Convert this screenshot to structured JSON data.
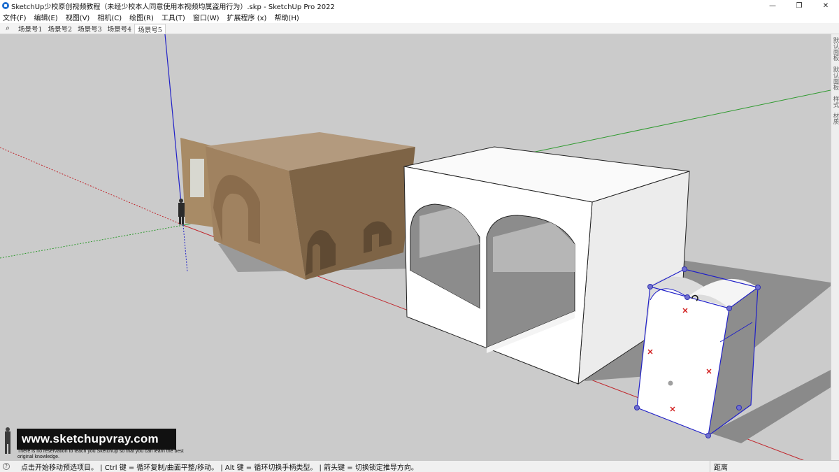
{
  "window": {
    "title": "SketchUp少校原创视频教程（未经少校本人同意使用本视频均属盗用行为）.skp - SketchUp Pro 2022",
    "controls": {
      "minimize": "—",
      "maximize": "❐",
      "close": "✕"
    }
  },
  "menu": [
    {
      "label": "文件(F)"
    },
    {
      "label": "编辑(E)"
    },
    {
      "label": "视图(V)"
    },
    {
      "label": "相机(C)"
    },
    {
      "label": "绘图(R)"
    },
    {
      "label": "工具(T)"
    },
    {
      "label": "窗口(W)"
    },
    {
      "label": "扩展程序 (x)"
    },
    {
      "label": "帮助(H)"
    }
  ],
  "scenes": {
    "search_icon": "⌕",
    "tabs": [
      {
        "label": "场景号1"
      },
      {
        "label": "场景号2"
      },
      {
        "label": "场景号3"
      },
      {
        "label": "场景号4"
      },
      {
        "label": "场景号5"
      }
    ],
    "active_index": 4
  },
  "tray": {
    "tabs": [
      {
        "label": "默认面板"
      },
      {
        "label": "默认面板"
      },
      {
        "label": "样式"
      },
      {
        "label": "材质"
      }
    ]
  },
  "watermark": {
    "url": "www.sketchupvray.com",
    "tagline": "There is no reservation to teach you SketchUp so that you can learn the best original knowledge."
  },
  "status": {
    "icon": "?",
    "message": "点击开始移动预选项目。 | Ctrl 键 = 循环复制/曲面平整/移动。 | Alt 键 = 循环切换手柄类型。 | 箭头键 = 切换锁定推导方向。",
    "measure_label": "距离"
  },
  "colors": {
    "viewport_bg": "#cbcbcb",
    "axis_red": "#c0272d",
    "axis_green": "#2e9a2e",
    "axis_blue": "#2222c8",
    "wood": "#9a7b58",
    "selection": "#2020c8"
  }
}
